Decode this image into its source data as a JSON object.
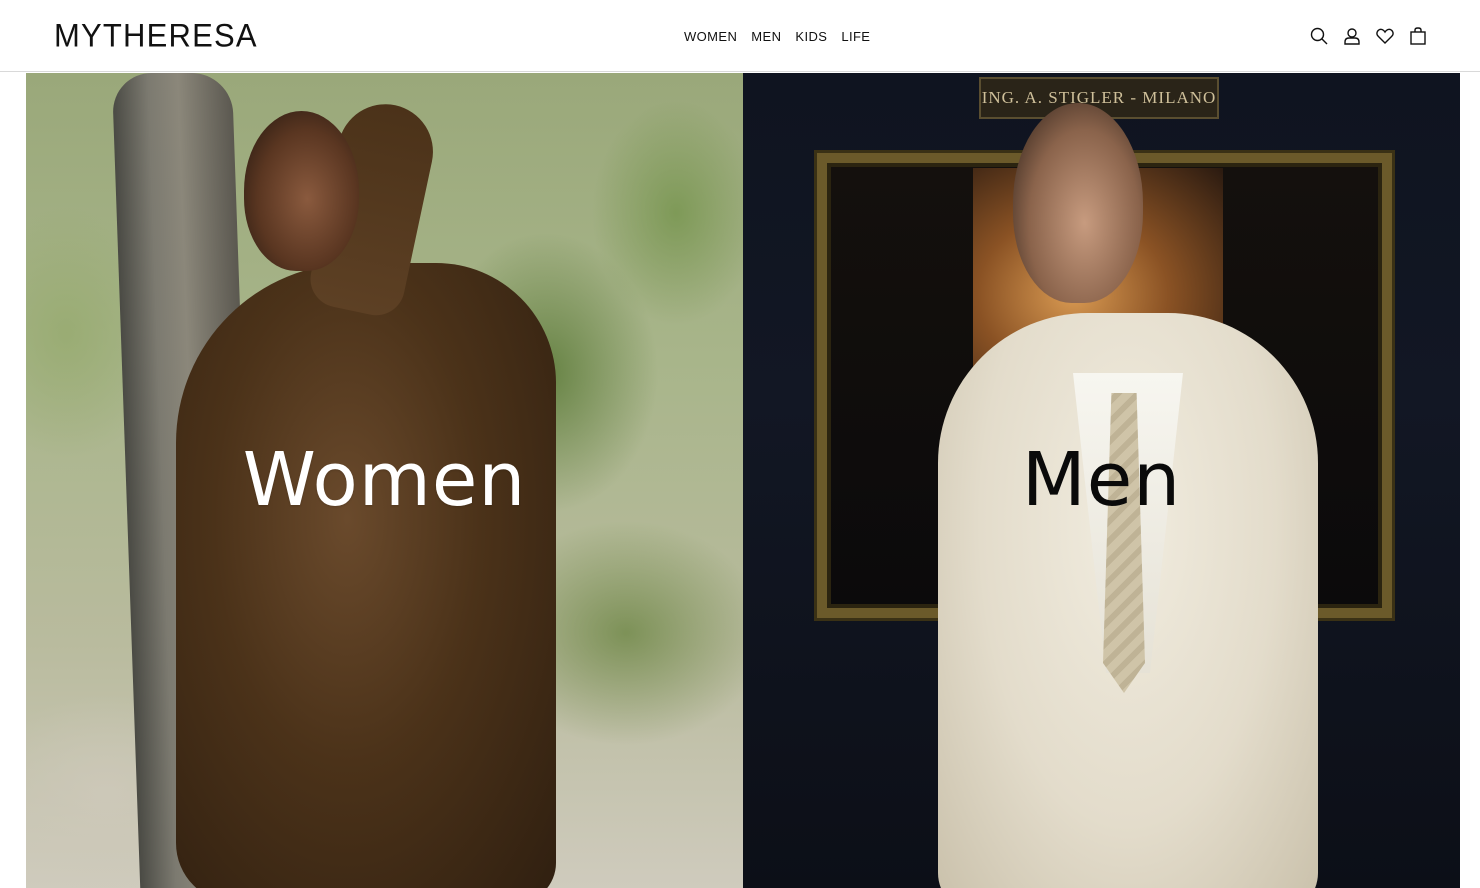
{
  "header": {
    "logo": "MYTHERESA",
    "nav": [
      {
        "label": "WOMEN"
      },
      {
        "label": "MEN"
      },
      {
        "label": "KIDS"
      },
      {
        "label": "LIFE"
      }
    ],
    "icons": [
      "search-icon",
      "account-icon",
      "wishlist-icon",
      "shopping-bag-icon"
    ]
  },
  "hero": {
    "women": {
      "label": "Women"
    },
    "men": {
      "label": "Men",
      "plaque": "ING. A. STIGLER - MILANO"
    }
  },
  "colors": {
    "text": "#111111",
    "background": "#ffffff",
    "women_label": "#ffffff",
    "men_label": "#0a0a0a"
  }
}
